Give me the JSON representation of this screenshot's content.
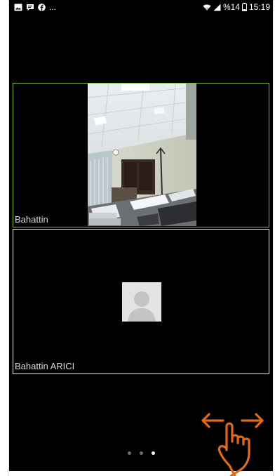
{
  "status_bar": {
    "left_icons": [
      "gallery-icon",
      "message-icon",
      "facebook-icon"
    ],
    "ellipsis": "...",
    "battery": "%14",
    "time": "15:19"
  },
  "participants": [
    {
      "name": "Bahattin",
      "video_on": true,
      "active_speaker": true
    },
    {
      "name": "Bahattin ARICI",
      "video_on": false,
      "active_speaker": false
    }
  ],
  "pager": {
    "count": 3,
    "active_index": 2
  },
  "gesture_hint": {
    "icon": "swipe-horizontal-hand-icon",
    "color": "#e06a1b"
  },
  "colors": {
    "active_border": "#7cbc44",
    "background": "#000000",
    "avatar_bg": "#e3e3e3"
  }
}
